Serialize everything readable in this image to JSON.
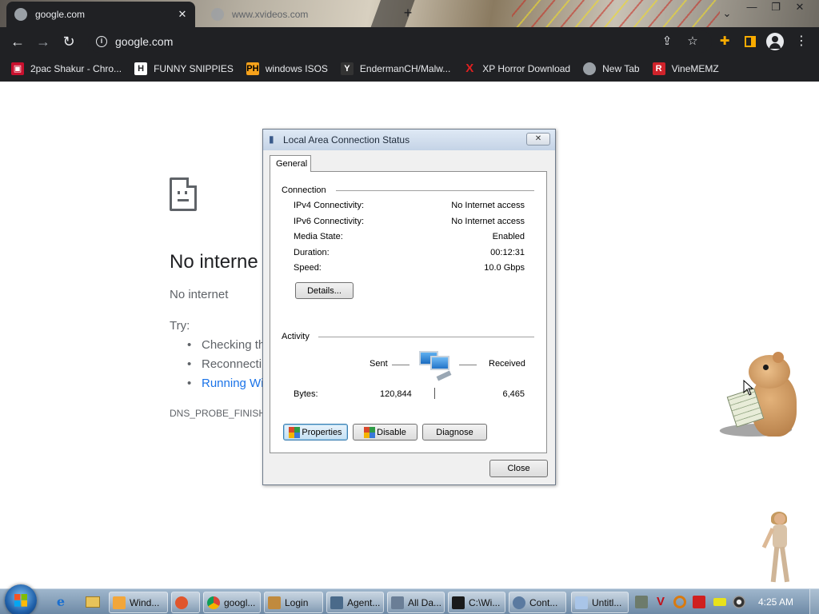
{
  "browser": {
    "tabs": [
      {
        "title": "google.com",
        "active": true
      },
      {
        "title": "www.xvideos.com",
        "active": false
      }
    ],
    "address": "google.com",
    "bookmarks": [
      {
        "label": "2pac Shakur - Chro...",
        "icon": "tupac-icon",
        "color": "#c8102e"
      },
      {
        "label": "FUNNY SNIPPIES",
        "icon": "h-icon",
        "color": "#ffffff"
      },
      {
        "label": "windows ISOS",
        "icon": "ph-icon",
        "color": "#f7a21b"
      },
      {
        "label": "EndermanCH/Malw...",
        "icon": "yp-icon",
        "color": "#333333"
      },
      {
        "label": "XP Horror Download",
        "icon": "x-icon",
        "color": "#e02020"
      },
      {
        "label": "New Tab",
        "icon": "globe-icon",
        "color": "#9aa0a6"
      },
      {
        "label": "VineMEMZ",
        "icon": "r-icon",
        "color": "#d0232b"
      }
    ]
  },
  "error_page": {
    "title": "No interne",
    "subtitle": "No internet",
    "try_label": "Try:",
    "suggestions": [
      "Checking th",
      "Reconnectin",
      "Running Wi"
    ],
    "error_code": "DNS_PROBE_FINISHED"
  },
  "dialog": {
    "title": "Local Area Connection Status",
    "tab": "General",
    "connection_label": "Connection",
    "rows": [
      {
        "label": "IPv4 Connectivity:",
        "value": "No Internet access"
      },
      {
        "label": "IPv6 Connectivity:",
        "value": "No Internet access"
      },
      {
        "label": "Media State:",
        "value": "Enabled"
      },
      {
        "label": "Duration:",
        "value": "00:12:31"
      },
      {
        "label": "Speed:",
        "value": "10.0 Gbps"
      }
    ],
    "details_button": "Details...",
    "activity_label": "Activity",
    "sent_label": "Sent",
    "received_label": "Received",
    "bytes_label": "Bytes:",
    "bytes_sent": "120,844",
    "bytes_received": "6,465",
    "properties_button": "Properties",
    "disable_button": "Disable",
    "diagnose_button": "Diagnose",
    "close_button": "Close"
  },
  "taskbar": {
    "items": [
      {
        "label": "Wind...",
        "icon": "media-player-icon",
        "color": "#f2a63a"
      },
      {
        "label": "",
        "icon": "app-icon",
        "color": "#e0562d"
      },
      {
        "label": "googl...",
        "icon": "chrome-icon",
        "color": "#db4437"
      },
      {
        "label": "Login",
        "icon": "login-icon",
        "color": "#c08a3e"
      },
      {
        "label": "Agent...",
        "icon": "agent-icon",
        "color": "#4a6a8a"
      },
      {
        "label": "All Da...",
        "icon": "window-icon",
        "color": "#6a7e96"
      },
      {
        "label": "C:\\Wi...",
        "icon": "cmd-icon",
        "color": "#1a1a1a"
      },
      {
        "label": "Cont...",
        "icon": "control-panel-icon",
        "color": "#5a7aa0"
      },
      {
        "label": "Untitl...",
        "icon": "notepad-icon",
        "color": "#a9c5e8"
      }
    ],
    "clock": "4:25 AM"
  }
}
